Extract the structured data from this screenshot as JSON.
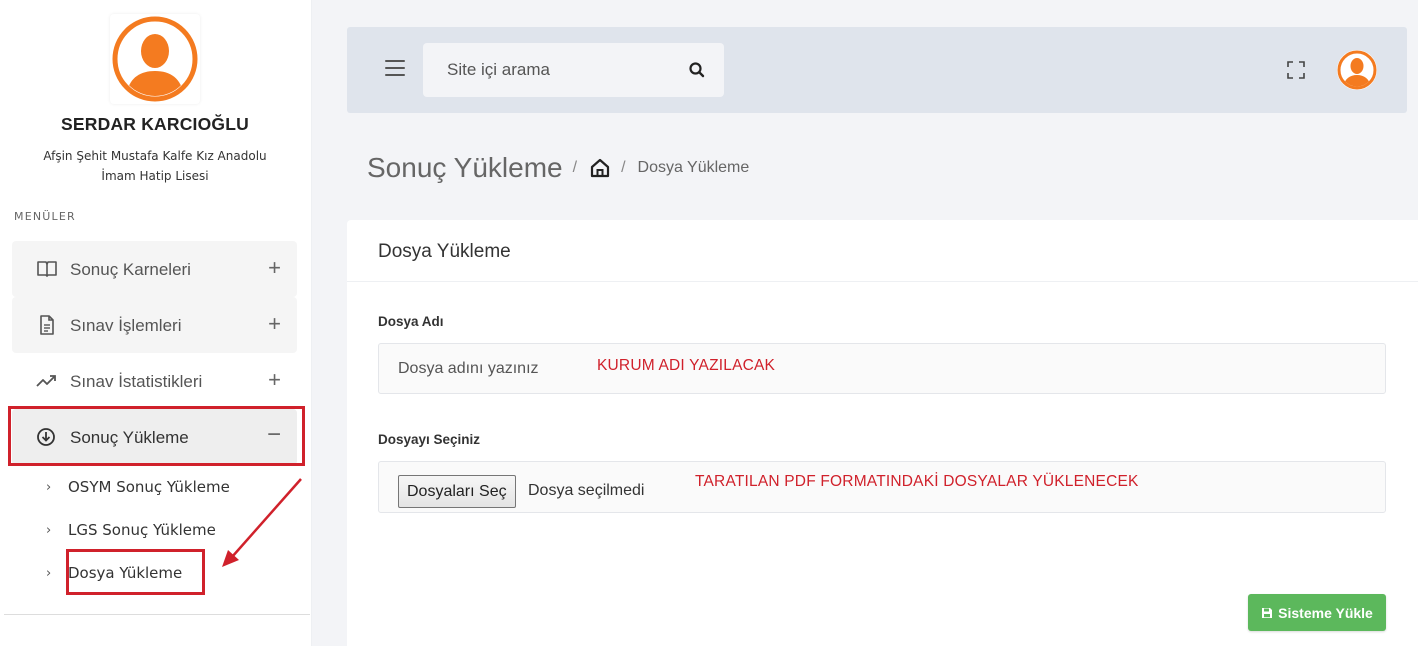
{
  "user": {
    "name": "SERDAR KARCIOĞLU",
    "school_line1": "Afşin Şehit Mustafa Kalfe Kız Anadolu",
    "school_line2": "İmam Hatip Lisesi",
    "avatar_icon": "user-avatar-icon",
    "avatar_color": "#f47b20"
  },
  "sidebar": {
    "caption": "MENÜLER",
    "items": [
      {
        "label": "Sonuç Karneleri",
        "icon": "open-book-icon",
        "toggle": "+"
      },
      {
        "label": "Sınav İşlemleri",
        "icon": "document-icon",
        "toggle": "+"
      },
      {
        "label": "Sınav İstatistikleri",
        "icon": "trending-up-icon",
        "toggle": "+"
      },
      {
        "label": "Sonuç Yükleme",
        "icon": "download-circle-icon",
        "toggle": "−"
      }
    ],
    "subitems": [
      {
        "label": "OSYM Sonuç Yükleme",
        "chevron": "›"
      },
      {
        "label": "LGS Sonuç Yükleme",
        "chevron": "›"
      },
      {
        "label": "Dosya Yükleme",
        "chevron": "›"
      }
    ]
  },
  "topbar": {
    "search_placeholder": "Site içi arama",
    "icons": [
      "menu-icon",
      "search-icon",
      "fullscreen-icon",
      "user-avatar-icon"
    ]
  },
  "breadcrumb": {
    "title": "Sonuç Yükleme",
    "separator": "/",
    "home_icon": "home-icon",
    "current": "Dosya Yükleme"
  },
  "card": {
    "title": "Dosya Yükleme",
    "file_name_label": "Dosya Adı",
    "file_name_placeholder": "Dosya adını yazınız",
    "file_name_note": "KURUM ADI YAZILACAK",
    "file_select_label": "Dosyayı Seçiniz",
    "file_button": "Dosyaları Seç",
    "file_status": "Dosya seçilmedi",
    "file_note": "TARATILAN PDF FORMATINDAKİ DOSYALAR YÜKLENECEK",
    "submit_label": "Sisteme Yükle",
    "submit_icon": "save-icon"
  },
  "colors": {
    "accent_orange": "#f47b20",
    "annotation_red": "#d0212b",
    "submit_green": "#5cb85c",
    "topbar_bg": "#dfe4ec"
  }
}
